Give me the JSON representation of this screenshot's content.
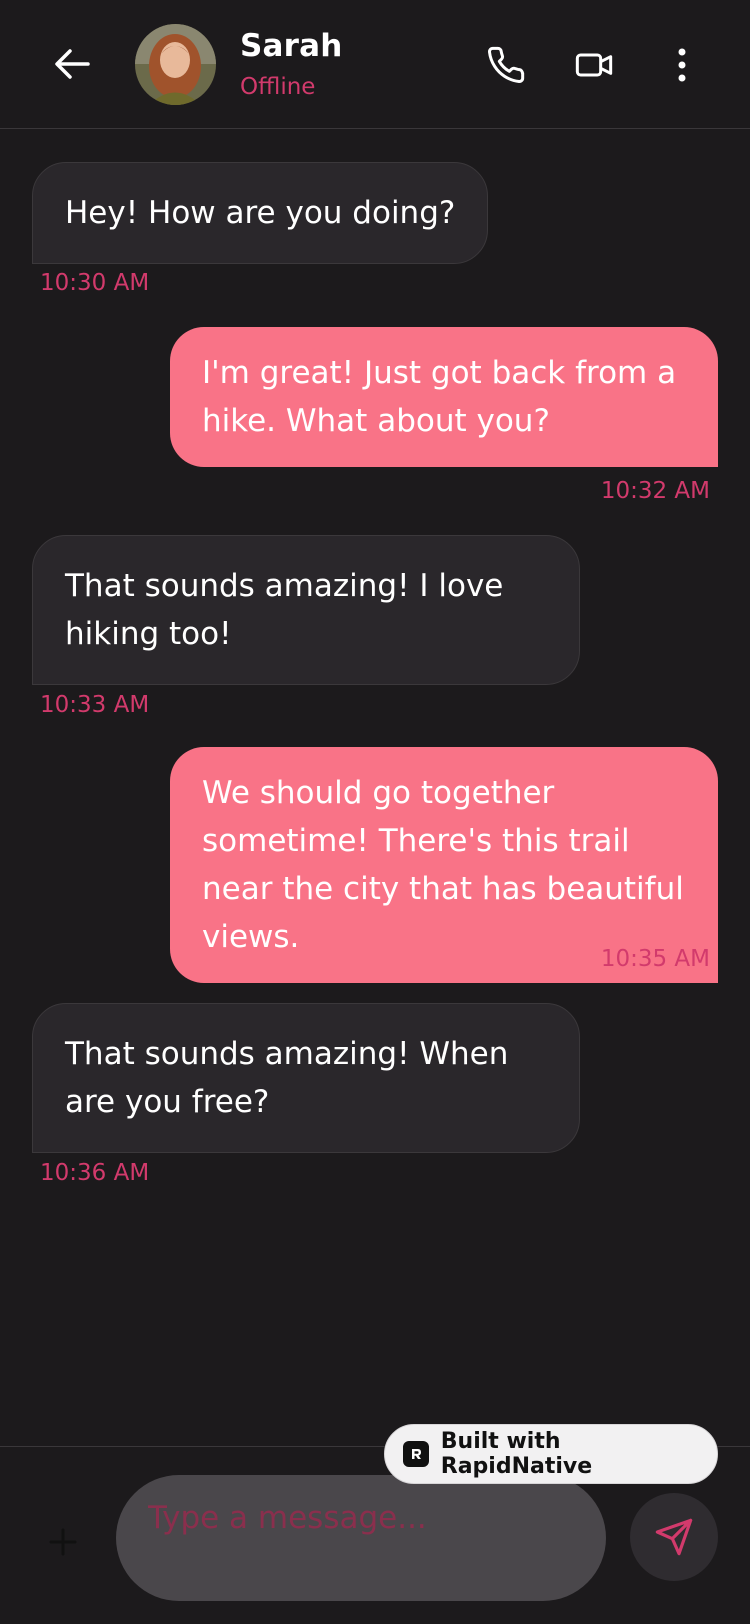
{
  "header": {
    "contact_name": "Sarah",
    "contact_status": "Offline",
    "back_icon": "arrow-left-icon",
    "call_icon": "phone-icon",
    "video_icon": "video-camera-icon",
    "menu_icon": "more-vertical-icon"
  },
  "messages": [
    {
      "direction": "in",
      "text": "Hey! How are you doing?",
      "time": "10:30 AM"
    },
    {
      "direction": "out",
      "text": "I'm great! Just got back from a hike. What about you?",
      "time": "10:32 AM"
    },
    {
      "direction": "in",
      "text": "That sounds amazing! I love hiking too!",
      "time": "10:33 AM"
    },
    {
      "direction": "out",
      "text": "We should go together sometime! There's this trail near the city that has beautiful views.",
      "time": "10:35 AM"
    },
    {
      "direction": "in",
      "text": "That sounds amazing! When are you free?",
      "time": "10:36 AM"
    }
  ],
  "composer": {
    "placeholder": "Type a message...",
    "attach_icon": "plus-icon",
    "send_icon": "send-icon"
  },
  "badge": {
    "label": "Built with RapidNative"
  },
  "colors": {
    "background": "#1c1a1c",
    "accent": "#d23a6c",
    "outgoing_bubble": "#f97387",
    "incoming_bubble": "#2a272b"
  }
}
